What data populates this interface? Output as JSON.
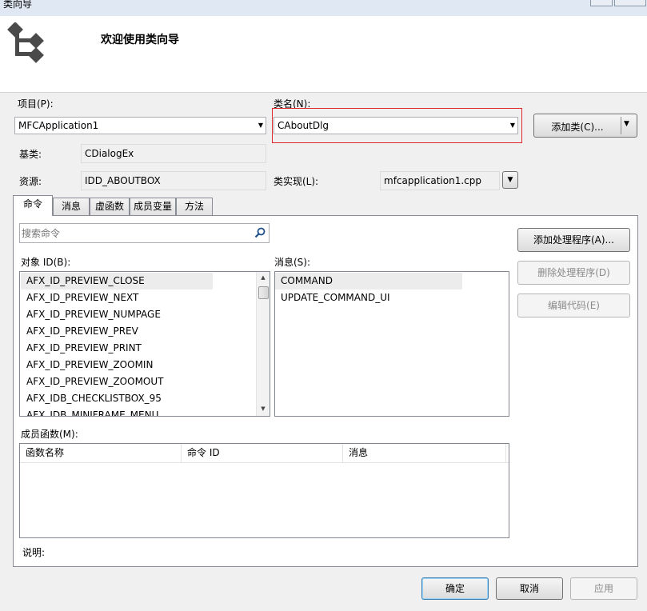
{
  "window": {
    "title": "类向导"
  },
  "banner": {
    "welcome": "欢迎使用类向导"
  },
  "project": {
    "label": "项目(P):",
    "value": "MFCApplication1"
  },
  "class_name": {
    "label": "类名(N):",
    "value": "CAboutDlg"
  },
  "add_class_button": "添加类(C)...",
  "base_class": {
    "label": "基类:",
    "value": "CDialogEx"
  },
  "resource": {
    "label": "资源:",
    "value": "IDD_ABOUTBOX"
  },
  "class_impl": {
    "label": "类实现(L):",
    "value": "mfcapplication1.cpp"
  },
  "tabs": [
    "命令",
    "消息",
    "虚函数",
    "成员变量",
    "方法"
  ],
  "search": {
    "placeholder": "搜索命令"
  },
  "object_ids": {
    "label": "对象 ID(B):",
    "items": [
      "AFX_ID_PREVIEW_CLOSE",
      "AFX_ID_PREVIEW_NEXT",
      "AFX_ID_PREVIEW_NUMPAGE",
      "AFX_ID_PREVIEW_PREV",
      "AFX_ID_PREVIEW_PRINT",
      "AFX_ID_PREVIEW_ZOOMIN",
      "AFX_ID_PREVIEW_ZOOMOUT",
      "AFX_IDB_CHECKLISTBOX_95",
      "AFX_IDB_MINIFRAME_MENU"
    ]
  },
  "messages": {
    "label": "消息(S):",
    "items": [
      "COMMAND",
      "UPDATE_COMMAND_UI"
    ]
  },
  "actions": {
    "add_handler": "添加处理程序(A)...",
    "delete_handler": "删除处理程序(D)",
    "edit_code": "编辑代码(E)"
  },
  "member_functions": {
    "label": "成员函数(M):",
    "columns": [
      "函数名称",
      "命令 ID",
      "消息"
    ]
  },
  "description": {
    "label": "说明:"
  },
  "footer": {
    "ok": "确定",
    "cancel": "取消",
    "apply": "应用"
  },
  "colors": {
    "highlight_border": "#e0272b",
    "selected_row": "#ececec"
  },
  "icons": [
    "class-wizard-logo-icon",
    "search-icon",
    "dropdown-arrow-icon",
    "scroll-up-icon",
    "scroll-down-icon"
  ]
}
